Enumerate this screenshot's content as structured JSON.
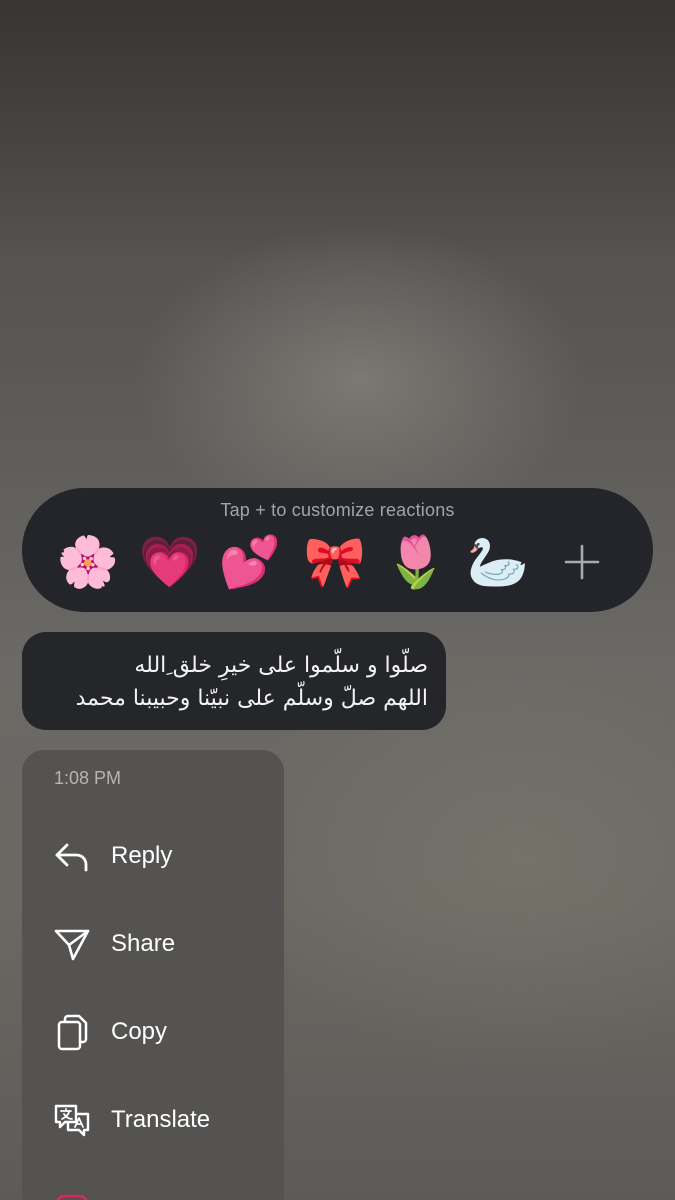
{
  "reactions": {
    "hint": "Tap + to customize reactions",
    "emojis": [
      {
        "icon": "cherry-blossom",
        "glyph": "🌸"
      },
      {
        "icon": "growing-heart",
        "glyph": "💗"
      },
      {
        "icon": "two-hearts",
        "glyph": "💕"
      },
      {
        "icon": "ribbon",
        "glyph": "🎀"
      },
      {
        "icon": "tulip",
        "glyph": "🌷"
      },
      {
        "icon": "swan",
        "glyph": "🦢"
      }
    ],
    "add_icon": "plus"
  },
  "message": {
    "line1": "صلّوا و سلّموا على خيرِ خلق ِالله",
    "line2": "اللهم صلّ وسلّم على نبيّنا وحبيبنا محمد"
  },
  "menu": {
    "timestamp": "1:08 PM",
    "items": [
      {
        "label": "Reply",
        "icon": "reply"
      },
      {
        "label": "Share",
        "icon": "share"
      },
      {
        "label": "Copy",
        "icon": "copy"
      },
      {
        "label": "Translate",
        "icon": "translate"
      }
    ],
    "partial_item_color": "#e0245e"
  },
  "colors": {
    "reaction_bar": "#24252a",
    "bubble": "#252629",
    "menu_panel": "#545351",
    "hint_text": "#a3a4a9"
  }
}
